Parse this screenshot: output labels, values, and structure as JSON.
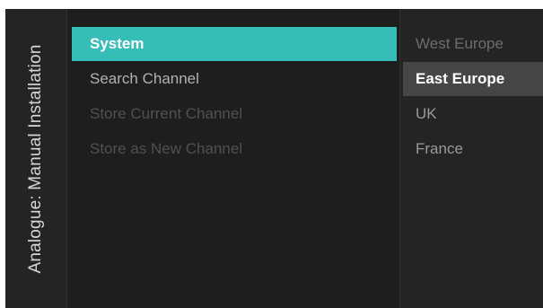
{
  "panel_title": "Analogue: Manual Installation",
  "menu": {
    "items": [
      {
        "label": "System"
      },
      {
        "label": "Search Channel"
      },
      {
        "label": "Store Current Channel"
      },
      {
        "label": "Store as New Channel"
      }
    ]
  },
  "options": {
    "items": [
      {
        "label": "West Europe"
      },
      {
        "label": "East Europe"
      },
      {
        "label": "UK"
      },
      {
        "label": "France"
      }
    ]
  },
  "colors": {
    "accent": "#36bdb8",
    "background": "#1e1e1e",
    "option_highlight": "#464646"
  }
}
